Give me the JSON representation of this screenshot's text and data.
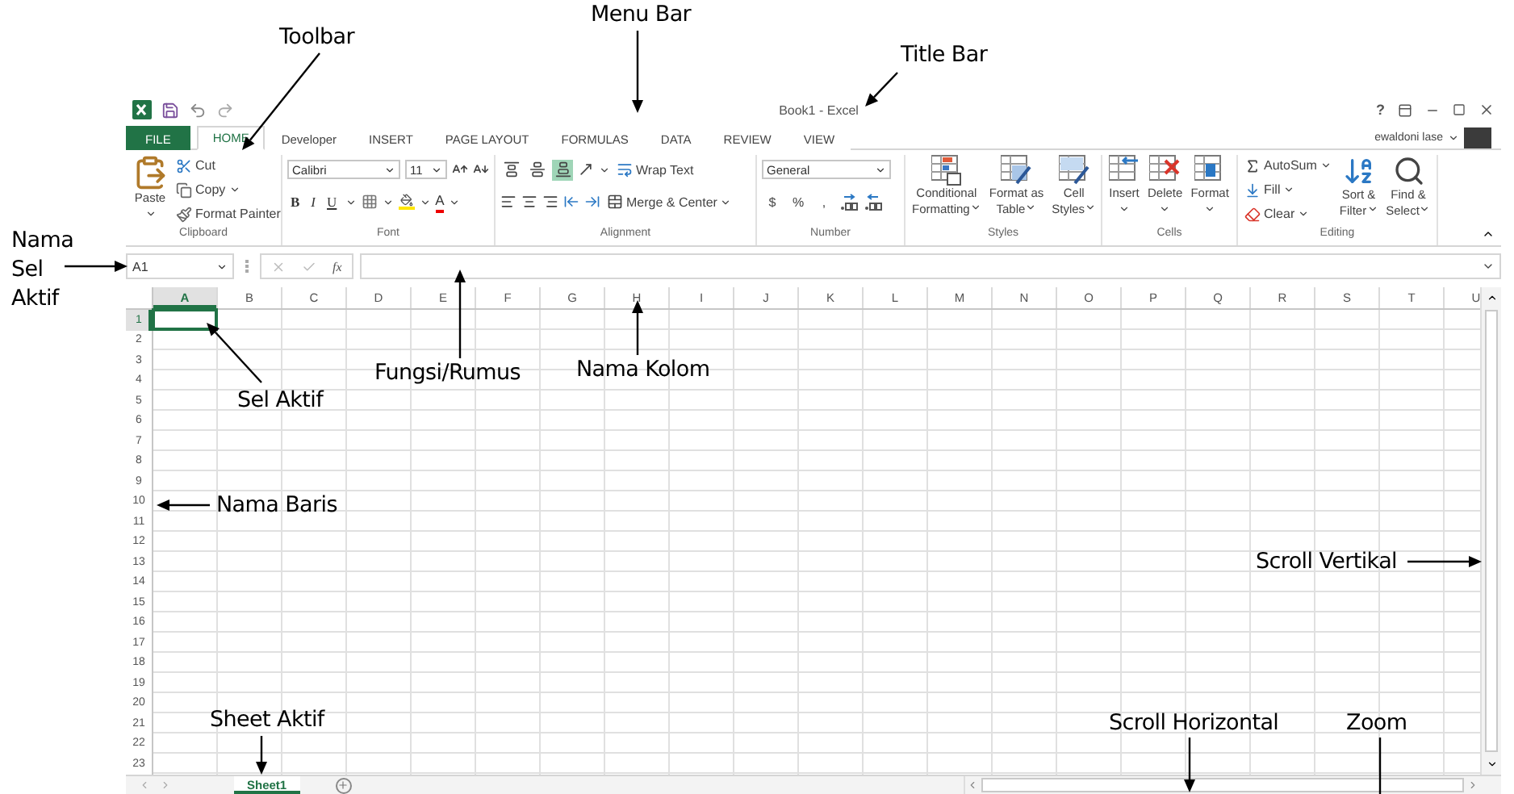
{
  "annotations": [
    {
      "text": "Menu Bar"
    },
    {
      "text": "Toolbar"
    },
    {
      "text": "Title Bar"
    },
    {
      "text": "Nama\nSel\nAktif"
    },
    {
      "text": "Fungsi/Rumus"
    },
    {
      "text": "Nama Kolom"
    },
    {
      "text": "Sel Aktif"
    },
    {
      "text": "Nama Baris"
    },
    {
      "text": "Scroll Vertikal"
    },
    {
      "text": "Sheet Aktif"
    },
    {
      "text": "Scroll Horizontal"
    },
    {
      "text": "Zoom"
    }
  ],
  "window": {
    "title": "Book1 - Excel",
    "help": "?"
  },
  "tabs": [
    {
      "label": "FILE",
      "kind": "file",
      "selected": false
    },
    {
      "label": "HOME",
      "kind": "tab",
      "selected": true
    },
    {
      "label": "Developer",
      "kind": "tab",
      "selected": false
    },
    {
      "label": "INSERT",
      "kind": "tab",
      "selected": false
    },
    {
      "label": "PAGE LAYOUT",
      "kind": "tab",
      "selected": false
    },
    {
      "label": "FORMULAS",
      "kind": "tab",
      "selected": false
    },
    {
      "label": "DATA",
      "kind": "tab",
      "selected": false
    },
    {
      "label": "REVIEW",
      "kind": "tab",
      "selected": false
    },
    {
      "label": "VIEW",
      "kind": "tab",
      "selected": false
    }
  ],
  "account": {
    "name": "ewaldoni lase"
  },
  "ribbon": {
    "clipboard": {
      "label": "Clipboard",
      "paste": "Paste",
      "items": [
        "Cut",
        "Copy",
        "Format Painter"
      ]
    },
    "font": {
      "label": "Font",
      "name": "Calibri",
      "size": "11",
      "styles": [
        "B",
        "I",
        "U"
      ],
      "color_letter": "A"
    },
    "alignment": {
      "label": "Alignment",
      "vertical": [
        {
          "selected": false
        },
        {
          "selected": false
        },
        {
          "selected": true
        }
      ],
      "wrap": "Wrap Text",
      "merge": "Merge & Center"
    },
    "number": {
      "label": "Number",
      "format": "General",
      "symbols": [
        "$",
        "%",
        ","
      ]
    },
    "styles": {
      "label": "Styles",
      "buttons": [
        "Conditional\nFormatting",
        "Format as\nTable",
        "Cell\nStyles"
      ]
    },
    "cells": {
      "label": "Cells",
      "buttons": [
        "Insert",
        "Delete",
        "Format"
      ]
    },
    "editing": {
      "label": "Editing",
      "items": [
        "AutoSum",
        "Fill",
        "Clear"
      ],
      "buttons": [
        "Sort &\nFilter",
        "Find &\nSelect"
      ]
    }
  },
  "formula_bar": {
    "name_box": "A1",
    "function_label": "fx"
  },
  "columns": [
    {
      "label": "A",
      "selected": true
    },
    {
      "label": "B",
      "selected": false
    },
    {
      "label": "C",
      "selected": false
    },
    {
      "label": "D",
      "selected": false
    },
    {
      "label": "E",
      "selected": false
    },
    {
      "label": "F",
      "selected": false
    },
    {
      "label": "G",
      "selected": false
    },
    {
      "label": "H",
      "selected": false
    },
    {
      "label": "I",
      "selected": false
    },
    {
      "label": "J",
      "selected": false
    },
    {
      "label": "K",
      "selected": false
    },
    {
      "label": "L",
      "selected": false
    },
    {
      "label": "M",
      "selected": false
    },
    {
      "label": "N",
      "selected": false
    },
    {
      "label": "O",
      "selected": false
    },
    {
      "label": "P",
      "selected": false
    },
    {
      "label": "Q",
      "selected": false
    },
    {
      "label": "R",
      "selected": false
    },
    {
      "label": "S",
      "selected": false
    },
    {
      "label": "T",
      "selected": false
    },
    {
      "label": "U",
      "selected": false
    }
  ],
  "rows": [
    {
      "label": "1",
      "selected": true
    },
    {
      "label": "2",
      "selected": false
    },
    {
      "label": "3",
      "selected": false
    },
    {
      "label": "4",
      "selected": false
    },
    {
      "label": "5",
      "selected": false
    },
    {
      "label": "6",
      "selected": false
    },
    {
      "label": "7",
      "selected": false
    },
    {
      "label": "8",
      "selected": false
    },
    {
      "label": "9",
      "selected": false
    },
    {
      "label": "10",
      "selected": false
    },
    {
      "label": "11",
      "selected": false
    },
    {
      "label": "12",
      "selected": false
    },
    {
      "label": "13",
      "selected": false
    },
    {
      "label": "14",
      "selected": false
    },
    {
      "label": "15",
      "selected": false
    },
    {
      "label": "16",
      "selected": false
    },
    {
      "label": "17",
      "selected": false
    },
    {
      "label": "18",
      "selected": false
    },
    {
      "label": "19",
      "selected": false
    },
    {
      "label": "20",
      "selected": false
    },
    {
      "label": "21",
      "selected": false
    },
    {
      "label": "22",
      "selected": false
    },
    {
      "label": "23",
      "selected": false
    }
  ],
  "sheets": [
    {
      "label": "Sheet1",
      "selected": true
    }
  ]
}
